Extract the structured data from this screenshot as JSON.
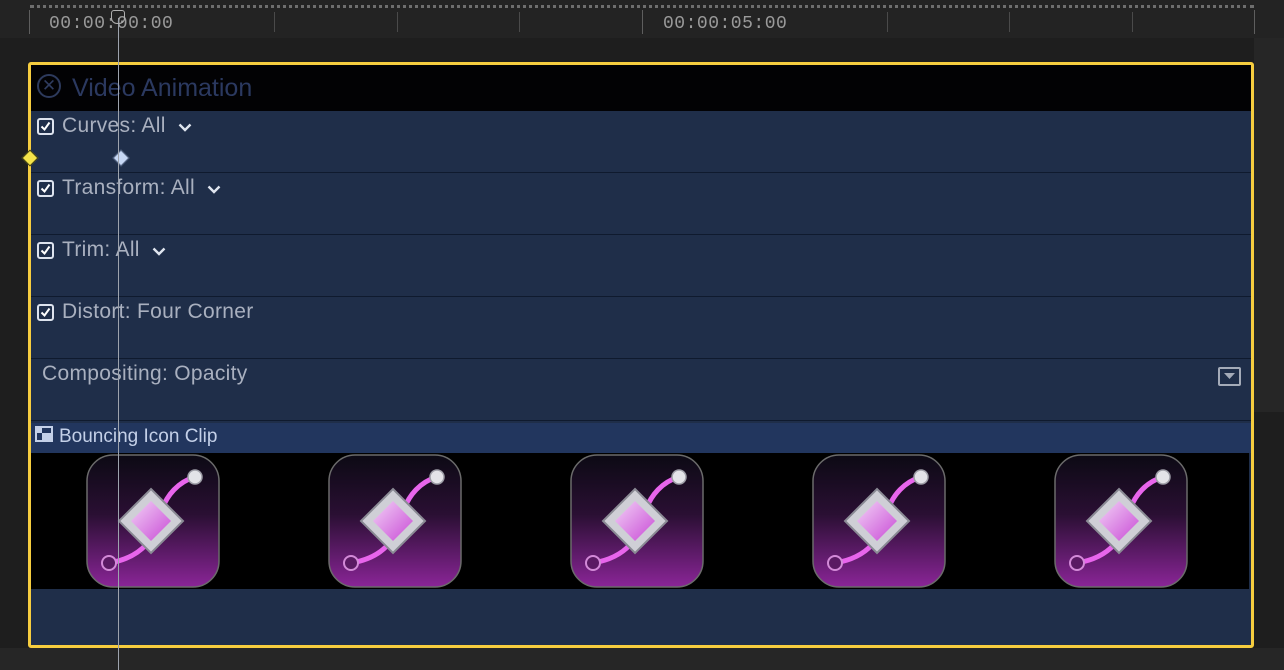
{
  "ruler": {
    "timecodes": [
      "00:00:00:00",
      "00:00:05:00"
    ]
  },
  "animation_editor": {
    "title": "Video Animation",
    "lanes": [
      {
        "label": "Curves: All",
        "checked": true,
        "has_menu": true
      },
      {
        "label": "Transform: All",
        "checked": true,
        "has_menu": true
      },
      {
        "label": "Trim: All",
        "checked": true,
        "has_menu": true
      },
      {
        "label": "Distort: Four Corner",
        "checked": true,
        "has_menu": false
      },
      {
        "label": "Compositing: Opacity",
        "checked": false,
        "has_menu": false
      }
    ]
  },
  "clip": {
    "name": "Bouncing Icon Clip",
    "thumbnail_count": 5
  },
  "colors": {
    "selection_border": "#f6cd3f",
    "lane_bg": "#1f2e49",
    "keyframe_start": "#f4e34a",
    "keyframe_selected": "#c6d7f4",
    "icon_magenta": "#c53fd0"
  },
  "icons": {
    "close": "close-circle-icon",
    "checkbox": "checkbox-checked-icon",
    "dropdown": "chevron-down-icon",
    "lane_menu": "disclosure-menu-icon",
    "clip": "clip-type-icon",
    "thumbnail": "motion-curve-app-icon"
  }
}
